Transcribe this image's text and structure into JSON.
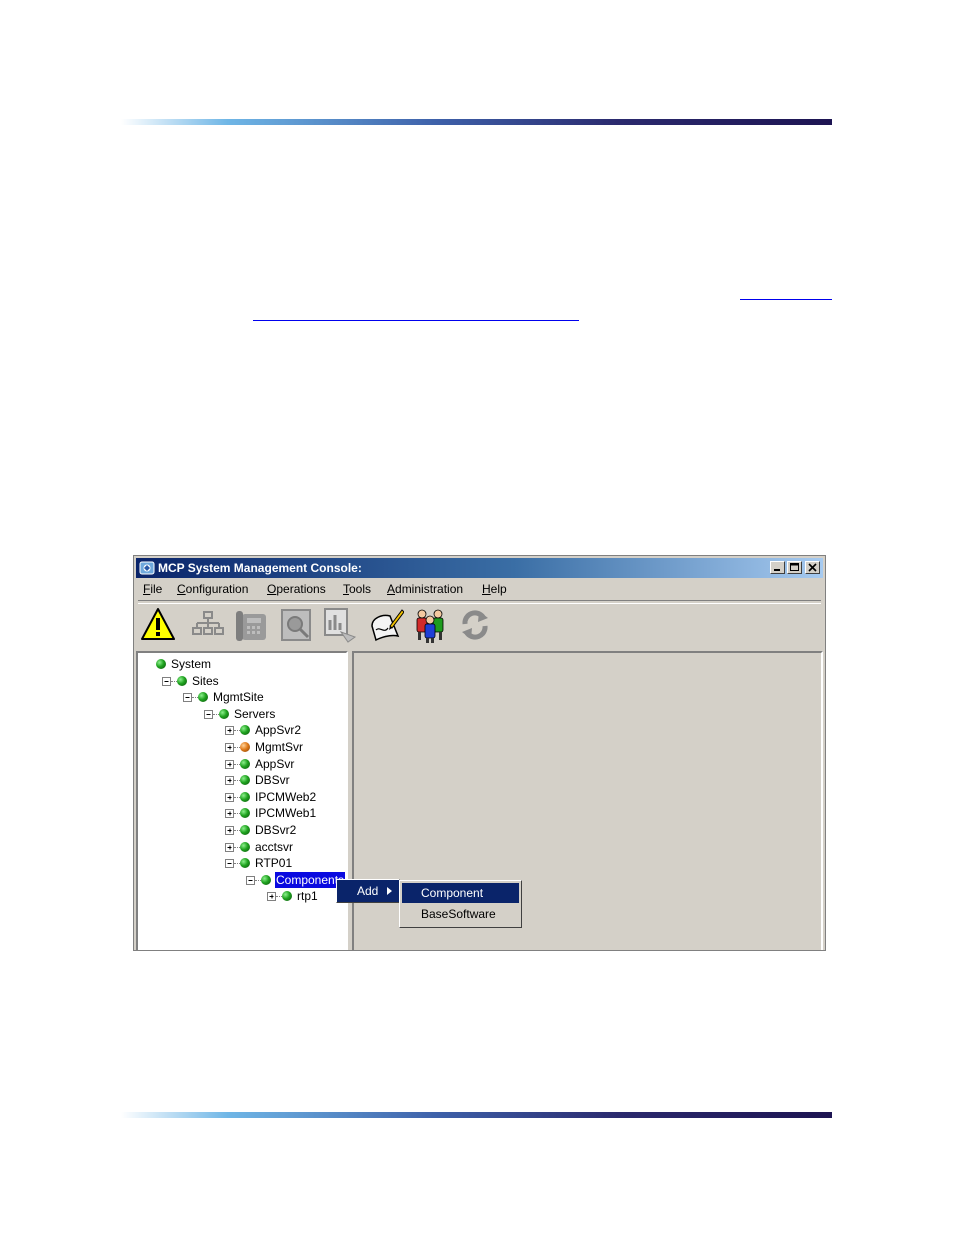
{
  "window": {
    "title": "MCP System Management Console:",
    "min_glyph": "_",
    "max_glyph": "□",
    "close_glyph": "×"
  },
  "menubar": [
    "File",
    "Configuration",
    "Operations",
    "Tools",
    "Administration",
    "Help"
  ],
  "toolbar": [
    {
      "icon": "alarm-warning-icon",
      "enabled": true
    },
    {
      "icon": "network-topology-icon",
      "enabled": false
    },
    {
      "icon": "telephone-icon",
      "enabled": false
    },
    {
      "icon": "magnifier-report-icon",
      "enabled": false
    },
    {
      "icon": "chart-report-icon",
      "enabled": false
    },
    {
      "icon": "signature-scroll-icon",
      "enabled": true
    },
    {
      "icon": "users-group-icon",
      "enabled": true
    },
    {
      "icon": "refresh-icon",
      "enabled": false
    }
  ],
  "tree": [
    {
      "label": "System",
      "level": 0,
      "status": "green",
      "expander": "none"
    },
    {
      "label": "Sites",
      "level": 1,
      "status": "green",
      "expander": "minus"
    },
    {
      "label": "MgmtSite",
      "level": 2,
      "status": "green",
      "expander": "minus"
    },
    {
      "label": "Servers",
      "level": 3,
      "status": "green",
      "expander": "minus"
    },
    {
      "label": "AppSvr2",
      "level": 4,
      "status": "green",
      "expander": "plus"
    },
    {
      "label": "MgmtSvr",
      "level": 4,
      "status": "orange",
      "expander": "plus"
    },
    {
      "label": "AppSvr",
      "level": 4,
      "status": "green",
      "expander": "plus"
    },
    {
      "label": "DBSvr",
      "level": 4,
      "status": "green",
      "expander": "plus"
    },
    {
      "label": "IPCMWeb2",
      "level": 4,
      "status": "green",
      "expander": "plus"
    },
    {
      "label": "IPCMWeb1",
      "level": 4,
      "status": "green",
      "expander": "plus"
    },
    {
      "label": "DBSvr2",
      "level": 4,
      "status": "green",
      "expander": "plus"
    },
    {
      "label": "acctsvr",
      "level": 4,
      "status": "green",
      "expander": "plus"
    },
    {
      "label": "RTP01",
      "level": 4,
      "status": "green",
      "expander": "minus"
    },
    {
      "label": "Components",
      "level": 5,
      "status": "green",
      "expander": "minus",
      "selected": true
    },
    {
      "label": "rtp1",
      "level": 6,
      "status": "green",
      "expander": "plus"
    }
  ],
  "context_menu": {
    "add_label": "Add",
    "submenu": [
      {
        "label": "Component",
        "highlighted": true
      },
      {
        "label": "BaseSoftware",
        "highlighted": false
      }
    ]
  }
}
